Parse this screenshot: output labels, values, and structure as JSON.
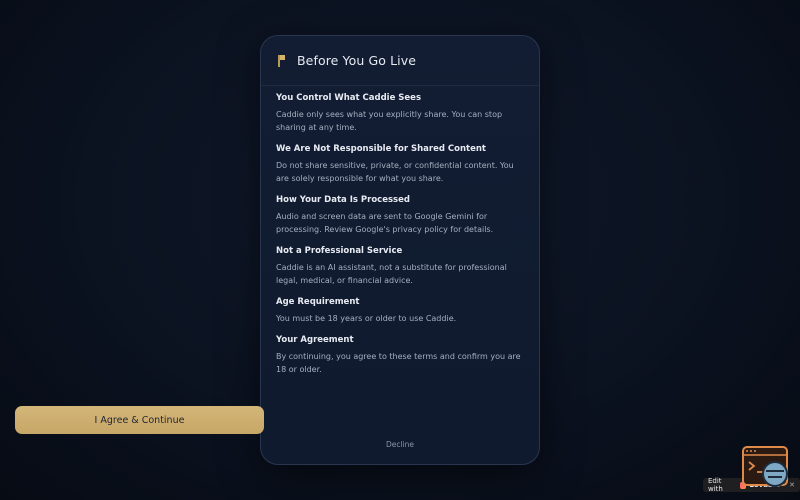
{
  "modal": {
    "title": "Before You Go Live",
    "icon": "flag-icon",
    "sections": [
      {
        "heading": "You Control What Caddie Sees",
        "body": "Caddie only sees what you explicitly share. You can stop sharing at any time."
      },
      {
        "heading": "We Are Not Responsible for Shared Content",
        "body": "Do not share sensitive, private, or confidential content. You are solely responsible for what you share."
      },
      {
        "heading": "How Your Data Is Processed",
        "body": "Audio and screen data are sent to Google Gemini for processing. Review Google's privacy policy for details."
      },
      {
        "heading": "Not a Professional Service",
        "body": "Caddie is an AI assistant, not a substitute for professional legal, medical, or financial advice."
      },
      {
        "heading": "Age Requirement",
        "body": "You must be 18 years or older to use Caddie."
      },
      {
        "heading": "Your Agreement",
        "body": "By continuing, you agree to these terms and confirm you are 18 or older."
      }
    ],
    "agree_label": "I Agree & Continue",
    "decline_label": "Decline"
  },
  "badge": {
    "label": "Edit with",
    "brand": "Lovable"
  },
  "colors": {
    "accent": "#d4b679",
    "background": "#0b1220",
    "panel": "#121d33"
  }
}
